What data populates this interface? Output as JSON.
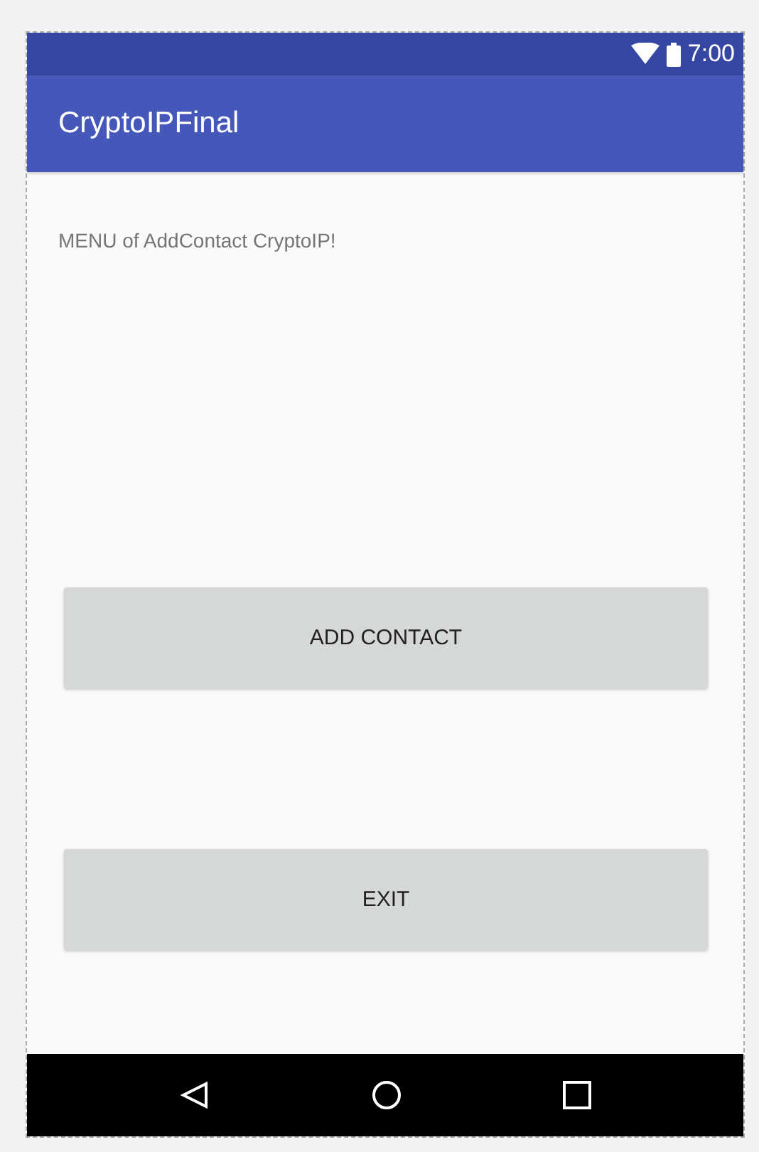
{
  "status_bar": {
    "time": "7:00"
  },
  "app_bar": {
    "title": "CryptoIPFinal"
  },
  "content": {
    "message": "MENU of AddContact CryptoIP!"
  },
  "buttons": [
    "ADD CONTACT",
    "EXIT"
  ]
}
